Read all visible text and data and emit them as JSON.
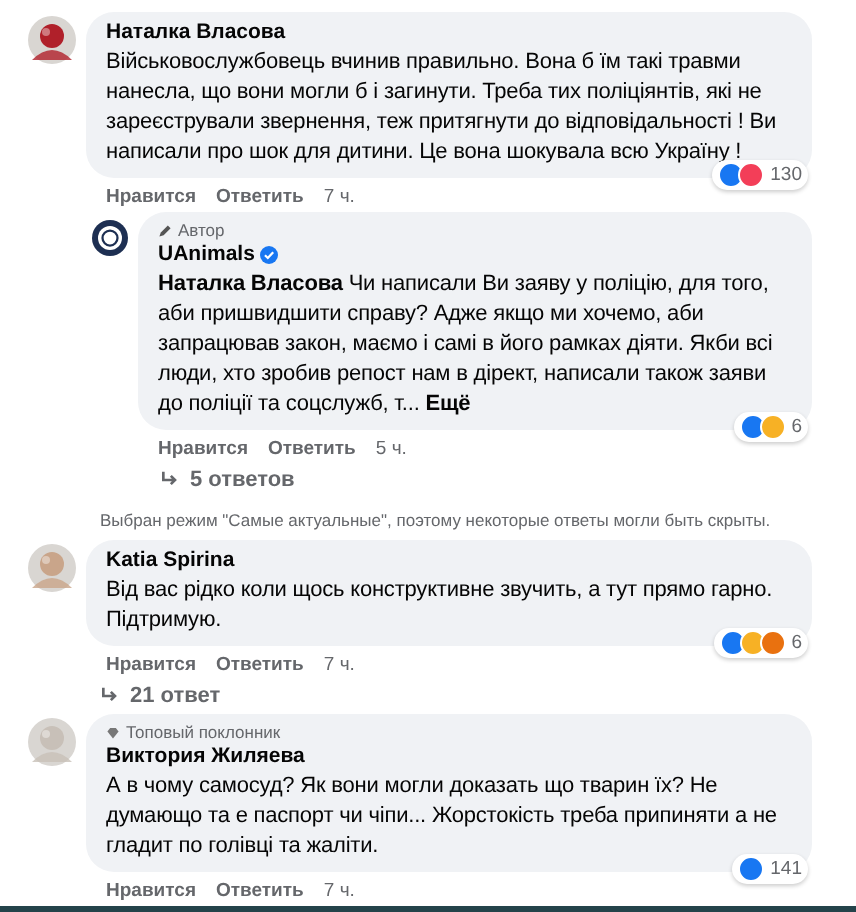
{
  "comments": [
    {
      "avatar": {
        "kind": "picture"
      },
      "author": "Наталка Власова",
      "text": "Військовослужбовець вчинив правильно. Вона б їм такі травми нанесла, що вони могли б і загинути. Треба тих поліціянтів, які не зареєстрували звернення, теж притягнути до відповідальності ! Ви написали про шок для дитини. Це вона шокувала всю Україну !",
      "actions": [
        "Нравится",
        "Ответить"
      ],
      "time": "7 ч.",
      "reactions": [
        {
          "kind": "like"
        },
        {
          "kind": "love"
        }
      ],
      "reaction_count": "130",
      "replies": [
        {
          "avatar": {
            "kind": "logo"
          },
          "badge": {
            "kind": "author",
            "label": "Автор"
          },
          "author": "UAnimals",
          "verified": true,
          "text": "**Наталка Власова** Чи написали Ви заяву у поліцію, для того, аби пришвидшити справу? Адже якщо ми хочемо, аби запрацював закон, маємо і самі в його рамках діяти. Якби всі люди, хто зробив репост нам в дірект, написали також заяви до поліції та соцслужб, т...",
          "more": "Ещё",
          "actions": [
            "Нравится",
            "Ответить"
          ],
          "time": "5 ч.",
          "reactions": [
            {
              "kind": "like"
            },
            {
              "kind": "haha"
            }
          ],
          "reaction_count": "6"
        }
      ],
      "more_replies": "5 ответов",
      "notice": "Выбран режим \"Самые актуальные\", поэтому некоторые ответы могли быть скрыты."
    },
    {
      "avatar": {
        "kind": "picture"
      },
      "author": "Katia Spirina",
      "text": "Від вас рідко коли щось конструктивне звучить, а тут прямо гарно. Підтримую.",
      "actions": [
        "Нравится",
        "Ответить"
      ],
      "time": "7 ч.",
      "reactions": [
        {
          "kind": "like"
        },
        {
          "kind": "sad"
        },
        {
          "kind": "angry"
        }
      ],
      "reaction_count": "6",
      "more_replies": "21 ответ"
    },
    {
      "avatar": {
        "kind": "picture"
      },
      "badge": {
        "kind": "fan",
        "label": "Топовый поклонник"
      },
      "author": "Виктория Жиляева",
      "text": "А в чому самосуд? Як вони могли доказать що тварин їх? Не думающо та е паспорт чи чіпи... Жорстокість треба припиняти а не гладит по голівці та жаліти.",
      "actions": [
        "Нравится",
        "Ответить"
      ],
      "time": "7 ч.",
      "reactions": [
        {
          "kind": "like"
        }
      ],
      "reaction_count": "141"
    }
  ]
}
